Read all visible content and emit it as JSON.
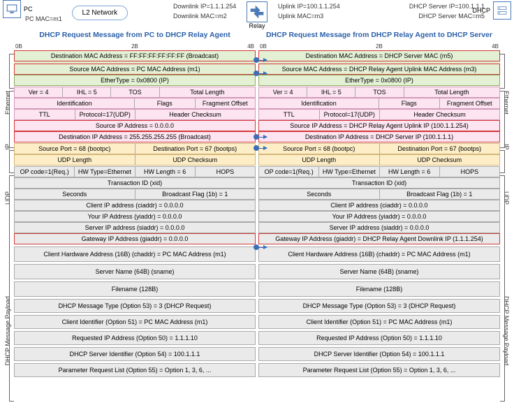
{
  "top": {
    "pcmac": "PC MAC=m1",
    "l2": "L2 Network",
    "dlip": "Downlink IP=1.1.1.254",
    "dlmac": "Downlink MAC=m2",
    "ulip": "Uplink IP=100.1.1.254",
    "ulmac": "Uplink MAC=m3",
    "srvip": "DHCP Server IP=100.1.1.1",
    "srvmac": "DHCP Server MAC=m5",
    "relay": "Relay",
    "pc": "PC",
    "dhcp": "DHCP"
  },
  "left": {
    "title": "DHCP Request Message from PC to DHCP Relay Agent",
    "b": [
      "0B",
      "2B",
      "4B"
    ],
    "eth": {
      "dst": "Destination MAC Address = FF:FF:FF:FF:FF:FF (Broadcast)",
      "src": "Source MAC Address = PC MAC Address (m1)",
      "et": "EtherType = 0x0800 (IP)"
    },
    "ip": {
      "r1": [
        "Ver = 4",
        "IHL = 5",
        "TOS",
        "Total Length"
      ],
      "r2": [
        "Identification",
        "Flags",
        "Fragment Offset"
      ],
      "r3": [
        "TTL",
        "Protocol=17(UDP)",
        "Header Checksum"
      ],
      "src": "Source IP Address = 0.0.0.0",
      "dst": "Destination IP Address = 255.255.255.255 (Broadcast)"
    },
    "udp": {
      "ports": [
        "Source Port = 68 (bootpc)",
        "Destination Port = 67 (bootps)"
      ],
      "len": [
        "UDP Length",
        "UDP Checksum"
      ]
    },
    "p": {
      "r1": [
        "OP code=1(Req.)",
        "HW Type=Ethernet",
        "HW Length = 6",
        "HOPS"
      ],
      "xid": "Transaction ID (xid)",
      "sec": [
        "Seconds",
        "Broadcast Flag (1b) = 1"
      ],
      "ci": "Client IP address (ciaddr) = 0.0.0.0",
      "yi": "Your IP Address (yiaddr) = 0.0.0.0",
      "si": "Server IP address (siaddr) = 0.0.0.0",
      "gi": "Gateway IP Address (giaddr) = 0.0.0.0",
      "ch": "Client Hardware Address (16B) (chaddr) = PC MAC Address (m1)",
      "sn": "Server Name (64B) (sname)",
      "fn": "Filename (128B)",
      "o53": "DHCP Message Type (Option 53) = 3 (DHCP Request)",
      "o51": "Client Identifier (Option 51) = PC MAC Address (m1)",
      "o50": "Requested IP Address (Option 50) = 1.1.1.10",
      "o54": "DHCP Server Identifier (Option 54) = 100.1.1.1",
      "o55": "Parameter Request List (Option 55) = Option 1, 3, 6, ..."
    }
  },
  "right": {
    "title": "DHCP Request Message from DHCP Relay Agent to DHCP Server",
    "b": [
      "0B",
      "2B",
      "4B"
    ],
    "eth": {
      "dst": "Destination MAC Address = DHCP Server MAC (m5)",
      "src": "Source MAC Address = DHCP Relay Agent Uplink MAC Address (m3)",
      "et": "EtherType = 0x0800 (IP)"
    },
    "ip": {
      "r1": [
        "Ver = 4",
        "IHL = 5",
        "TOS",
        "Total Length"
      ],
      "r2": [
        "Identification",
        "Flags",
        "Fragment Offset"
      ],
      "r3": [
        "TTL",
        "Protocol=17(UDP)",
        "Header Checksum"
      ],
      "src": "Source IP Address = DHCP Relay Agent Uplink IP (100.1.1.254)",
      "dst": "Destination IP Address = DHCP Server IP (100.1.1.1)"
    },
    "udp": {
      "ports": [
        "Source Port = 68 (bootpc)",
        "Destination Port = 67 (bootps)"
      ],
      "len": [
        "UDP Length",
        "UDP Checksum"
      ]
    },
    "p": {
      "r1": [
        "OP code=1(Req.)",
        "HW Type=Ethernet",
        "HW Length = 6",
        "HOPS"
      ],
      "xid": "Transaction ID (xid)",
      "sec": [
        "Seconds",
        "Broadcast Flag (1b) = 1"
      ],
      "ci": "Client IP address (ciaddr) = 0.0.0.0",
      "yi": "Your IP Address (yiaddr) = 0.0.0.0",
      "si": "Server IP address (siaddr) = 0.0.0.0",
      "gi": "Gateway IP Address (giaddr) = DHCP Relay Agent Downlink IP (1.1.1.254)",
      "ch": "Client Hardware Address (16B) (chaddr) = PC MAC Address (m1)",
      "sn": "Server Name (64B) (sname)",
      "fn": "Filename (128B)",
      "o53": "DHCP Message Type (Option 53) = 3 (DHCP Request)",
      "o51": "Client Identifier (Option 51) = PC MAC Address (m1)",
      "o50": "Requested IP Address (Option 50) = 1.1.1.10",
      "o54": "DHCP Server Identifier (Option 54) = 100.1.1.1",
      "o55": "Parameter Request List (Option 55) = Option 1, 3, 6, ..."
    }
  },
  "vlabels": {
    "eth": "Ethernet",
    "ip": "IP",
    "udp": "UDP",
    "pay": "DHCP Message Payload"
  }
}
